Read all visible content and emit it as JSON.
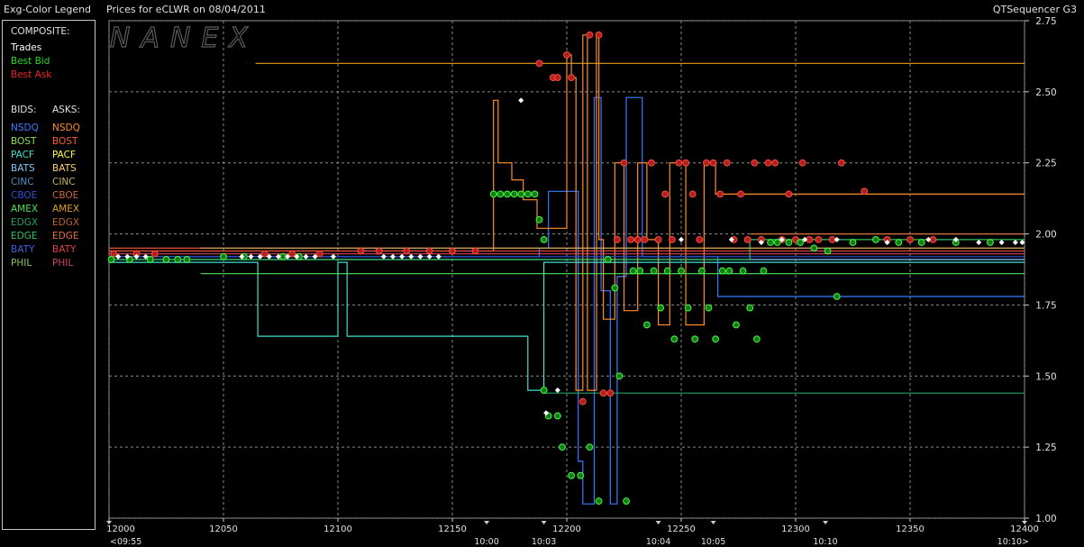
{
  "header": {
    "legend_title": "Exg-Color Legend",
    "prices_for": "Prices for  eCLWR  on  08/04/2011",
    "app_name": "QTSequencer G3"
  },
  "watermark": "NANEX",
  "legend": {
    "composite_label": "COMPOSITE:",
    "composite_items": [
      {
        "label": "Trades",
        "color": "#ffffff"
      },
      {
        "label": "Best Bid",
        "color": "#22dd22"
      },
      {
        "label": "Best Ask",
        "color": "#ee2222"
      }
    ],
    "bids_label": "BIDS:",
    "asks_label": "ASKS:",
    "exchanges": [
      {
        "bid": "NSDQ",
        "ask": "NSDQ",
        "bid_color": "#3a7bff",
        "ask_color": "#ff8c2a"
      },
      {
        "bid": "BOST",
        "ask": "BOST",
        "bid_color": "#8ee05a",
        "ask_color": "#ff5a3a"
      },
      {
        "bid": "PACF",
        "ask": "PACF",
        "bid_color": "#40e0d0",
        "ask_color": "#ffff40"
      },
      {
        "bid": "BATS",
        "ask": "BATS",
        "bid_color": "#80c8ff",
        "ask_color": "#ffd070"
      },
      {
        "bid": "CINC",
        "ask": "CINC",
        "bid_color": "#508cc8",
        "ask_color": "#c8b060"
      },
      {
        "bid": "CBOE",
        "ask": "CBOE",
        "bid_color": "#2a50d0",
        "ask_color": "#c86a3a"
      },
      {
        "bid": "AMEX",
        "ask": "AMEX",
        "bid_color": "#50e050",
        "ask_color": "#e0a020"
      },
      {
        "bid": "EDGX",
        "ask": "EDGX",
        "bid_color": "#20a060",
        "ask_color": "#c06030"
      },
      {
        "bid": "EDGE",
        "ask": "EDGE",
        "bid_color": "#30c060",
        "ask_color": "#e07040"
      },
      {
        "bid": "BATY",
        "ask": "BATY",
        "bid_color": "#4060e0",
        "ask_color": "#e04040"
      },
      {
        "bid": "PHIL",
        "ask": "PHIL",
        "bid_color": "#90c060",
        "ask_color": "#d04060"
      }
    ]
  },
  "chart_data": {
    "type": "line",
    "title": "Prices for  eCLWR  on  08/04/2011",
    "ylim": [
      1.0,
      2.75
    ],
    "xlim": [
      12000,
      12400
    ],
    "y_ticks": [
      "2.75",
      "2.50",
      "2.25",
      "2.00",
      "1.75",
      "1.50",
      "1.25",
      "1.00"
    ],
    "y_tick_values": [
      2.75,
      2.5,
      2.25,
      2.0,
      1.75,
      1.5,
      1.25,
      1.0
    ],
    "x_ticks": [
      "12000",
      "12050",
      "12100",
      "12150",
      "12200",
      "12250",
      "12300",
      "12350",
      "12400"
    ],
    "x_tick_values": [
      12000,
      12050,
      12100,
      12150,
      12200,
      12250,
      12300,
      12350,
      12400
    ],
    "time_labels": [
      {
        "x": 12000,
        "label": "<09:55"
      },
      {
        "x": 12165,
        "label": "10:00"
      },
      {
        "x": 12190,
        "label": "10:03"
      },
      {
        "x": 12240,
        "label": "10:04"
      },
      {
        "x": 12264,
        "label": "10:05"
      },
      {
        "x": 12313,
        "label": "10:10"
      },
      {
        "x": 12400,
        "label": "10:10>"
      }
    ],
    "grid": true,
    "series": [
      {
        "exchange": "NSDQ",
        "side": "bid",
        "color": "#3a7bff",
        "x": [
          12000,
          12188,
          12188,
          12192,
          12192,
          12205,
          12205,
          12207,
          12207,
          12212,
          12212,
          12215,
          12215,
          12219,
          12219,
          12222,
          12222,
          12226,
          12226,
          12233,
          12233,
          12266,
          12266,
          12400
        ],
        "y": [
          1.92,
          1.92,
          1.95,
          1.95,
          2.15,
          2.15,
          1.2,
          1.2,
          1.05,
          1.05,
          2.48,
          2.48,
          1.8,
          1.8,
          1.05,
          1.05,
          1.85,
          1.85,
          2.48,
          2.48,
          1.92,
          1.92,
          1.78,
          1.78
        ]
      },
      {
        "exchange": "NSDQ",
        "side": "ask",
        "color": "#ff8c2a",
        "x": [
          12000,
          12168,
          12168,
          12170,
          12170,
          12176,
          12176,
          12181,
          12181,
          12187,
          12187,
          12200,
          12200,
          12202,
          12202,
          12204,
          12204,
          12207,
          12207,
          12209,
          12209,
          12213,
          12213,
          12214,
          12214,
          12216,
          12216,
          12221,
          12221,
          12225,
          12225,
          12231,
          12231,
          12235,
          12235,
          12240,
          12240,
          12245,
          12245,
          12252,
          12252,
          12260,
          12260,
          12265,
          12265,
          12400
        ],
        "y": [
          1.94,
          1.94,
          2.47,
          2.47,
          2.25,
          2.25,
          2.19,
          2.19,
          2.12,
          2.12,
          2.02,
          2.02,
          2.63,
          2.63,
          2.55,
          2.55,
          1.45,
          1.45,
          2.7,
          2.7,
          1.45,
          1.45,
          2.7,
          2.7,
          1.98,
          1.98,
          1.7,
          1.7,
          2.25,
          2.25,
          1.73,
          1.73,
          2.25,
          2.25,
          1.98,
          1.98,
          1.68,
          1.68,
          2.25,
          2.25,
          1.68,
          1.68,
          2.25,
          2.25,
          2.14,
          2.14
        ]
      },
      {
        "exchange": "PACF",
        "side": "bid",
        "color": "#40e0d0",
        "x": [
          12000,
          12065,
          12065,
          12100,
          12100,
          12104,
          12104,
          12183,
          12183,
          12190,
          12190,
          12400
        ],
        "y": [
          1.9,
          1.9,
          1.64,
          1.64,
          1.9,
          1.9,
          1.64,
          1.64,
          1.45,
          1.45,
          1.9,
          1.9
        ]
      },
      {
        "exchange": "AMEX",
        "side": "ask",
        "color": "#e0a020",
        "x": [
          12064,
          12400
        ],
        "y": [
          2.6,
          2.6
        ]
      },
      {
        "exchange": "AMEX",
        "side": "bid",
        "color": "#50e050",
        "x": [
          12040,
          12400
        ],
        "y": [
          1.86,
          1.86
        ]
      },
      {
        "exchange": "EDGX",
        "side": "bid",
        "color": "#20a060",
        "x": [
          12190,
          12400
        ],
        "y": [
          1.44,
          1.44
        ]
      },
      {
        "exchange": "BOST",
        "side": "ask",
        "color": "#ff5a3a",
        "x": [
          12000,
          12400
        ],
        "y": [
          1.95,
          1.95
        ]
      },
      {
        "exchange": "BATY",
        "side": "ask",
        "color": "#e04040",
        "x": [
          12000,
          12400
        ],
        "y": [
          1.94,
          1.94
        ]
      },
      {
        "exchange": "PHIL",
        "side": "ask",
        "color": "#d04060",
        "x": [
          12000,
          12400
        ],
        "y": [
          1.93,
          1.93
        ]
      },
      {
        "exchange": "BATS",
        "side": "bid",
        "color": "#80c8ff",
        "x": [
          12000,
          12400
        ],
        "y": [
          1.91,
          1.91
        ]
      },
      {
        "exchange": "CBOE",
        "side": "bid",
        "color": "#2a50d0",
        "x": [
          12000,
          12400
        ],
        "y": [
          1.92,
          1.92
        ]
      },
      {
        "exchange": "EDGE",
        "side": "bid",
        "color": "#30c060",
        "x": [
          12000,
          12280,
          12280,
          12400
        ],
        "y": [
          1.91,
          1.91,
          1.98,
          1.98
        ]
      },
      {
        "exchange": "CINC",
        "side": "ask",
        "color": "#c8b060",
        "x": [
          12040,
          12400
        ],
        "y": [
          1.95,
          1.95
        ]
      },
      {
        "exchange": "EDGE",
        "side": "ask",
        "color": "#e07040",
        "x": [
          12280,
          12400
        ],
        "y": [
          2.0,
          2.0
        ]
      }
    ],
    "trades": {
      "color": "#ffffff",
      "x": [
        12004,
        12008,
        12012,
        12016,
        12058,
        12062,
        12066,
        12070,
        12074,
        12078,
        12082,
        12086,
        12090,
        12098,
        12120,
        12124,
        12128,
        12132,
        12136,
        12140,
        12144,
        12180,
        12191,
        12196,
        12250,
        12272,
        12285,
        12294,
        12304,
        12318,
        12340,
        12358,
        12370,
        12380,
        12390,
        12396,
        12399
      ],
      "y": [
        1.92,
        1.92,
        1.92,
        1.92,
        1.92,
        1.92,
        1.92,
        1.92,
        1.92,
        1.92,
        1.92,
        1.92,
        1.92,
        1.92,
        1.92,
        1.92,
        1.92,
        1.92,
        1.92,
        1.92,
        1.92,
        2.47,
        1.37,
        1.45,
        1.98,
        1.98,
        1.97,
        1.98,
        1.98,
        1.98,
        1.97,
        1.98,
        1.98,
        1.97,
        1.97,
        1.97,
        1.97
      ]
    },
    "best_bid": {
      "color": "#22dd22",
      "x": [
        12001,
        12009,
        12018,
        12025,
        12030,
        12034,
        12050,
        12059,
        12076,
        12083,
        12168,
        12171,
        12174,
        12177,
        12180,
        12183,
        12186,
        12188,
        12190,
        12190,
        12192,
        12196,
        12198,
        12202,
        12206,
        12210,
        12214,
        12218,
        12221,
        12223,
        12226,
        12229,
        12232,
        12235,
        12238,
        12241,
        12244,
        12247,
        12250,
        12253,
        12256,
        12259,
        12262,
        12265,
        12268,
        12271,
        12274,
        12277,
        12280,
        12283,
        12286,
        12289,
        12292,
        12297,
        12302,
        12308,
        12314,
        12318,
        12325,
        12335,
        12345,
        12355,
        12370,
        12385
      ],
      "y": [
        1.91,
        1.91,
        1.91,
        1.91,
        1.91,
        1.91,
        1.92,
        1.92,
        1.92,
        1.92,
        2.14,
        2.14,
        2.14,
        2.14,
        2.14,
        2.14,
        2.14,
        2.05,
        1.98,
        1.45,
        1.36,
        1.36,
        1.25,
        1.15,
        1.15,
        1.25,
        1.06,
        1.91,
        1.81,
        1.5,
        1.06,
        1.87,
        1.87,
        1.68,
        1.87,
        1.74,
        1.87,
        1.63,
        1.87,
        1.74,
        1.63,
        1.87,
        1.74,
        1.63,
        1.87,
        1.87,
        1.68,
        1.87,
        1.74,
        1.63,
        1.87,
        1.97,
        1.97,
        1.97,
        1.97,
        1.95,
        1.94,
        1.78,
        1.97,
        1.98,
        1.97,
        1.97,
        1.97,
        1.97
      ]
    },
    "best_ask": {
      "color": "#ee2222",
      "x": [
        12002,
        12012,
        12020,
        12068,
        12080,
        12092,
        12110,
        12118,
        12130,
        12140,
        12150,
        12160,
        12188,
        12194,
        12196,
        12200,
        12202,
        12207,
        12210,
        12214,
        12216,
        12219,
        12222,
        12225,
        12228,
        12231,
        12234,
        12237,
        12240,
        12243,
        12246,
        12249,
        12252,
        12255,
        12258,
        12261,
        12264,
        12267,
        12270,
        12273,
        12276,
        12279,
        12282,
        12285,
        12288,
        12291,
        12294,
        12297,
        12300,
        12303,
        12306,
        12310,
        12316,
        12320,
        12330,
        12340,
        12350,
        12360
      ],
      "y": [
        1.93,
        1.93,
        1.93,
        1.93,
        1.93,
        1.93,
        1.94,
        1.94,
        1.94,
        1.94,
        1.94,
        1.94,
        2.6,
        2.55,
        2.55,
        2.63,
        2.55,
        1.41,
        2.7,
        2.7,
        1.44,
        1.44,
        1.98,
        2.25,
        1.98,
        1.98,
        1.98,
        2.25,
        1.98,
        2.14,
        1.98,
        2.25,
        2.25,
        2.14,
        1.98,
        2.25,
        2.25,
        2.14,
        2.25,
        1.98,
        2.14,
        1.98,
        2.25,
        1.98,
        2.25,
        2.25,
        1.98,
        2.14,
        1.98,
        2.25,
        1.98,
        1.98,
        1.98,
        2.25,
        2.15,
        1.98,
        1.98,
        1.98
      ]
    }
  }
}
